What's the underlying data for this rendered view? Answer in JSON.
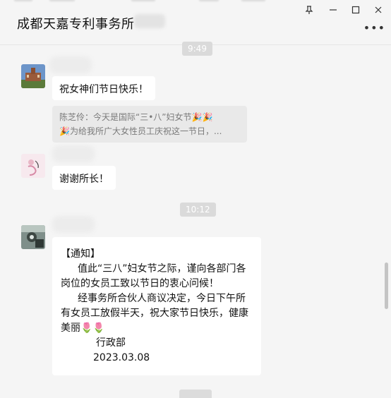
{
  "window": {
    "title": "成都天嘉专利事务所",
    "controls": {
      "pin_icon": "pin-icon",
      "minimize_icon": "minimize-icon",
      "maximize_icon": "maximize-icon",
      "close_icon": "close-icon"
    },
    "more_label": "•••"
  },
  "timestamps": [
    "9:49",
    "10:12"
  ],
  "messages": {
    "m1": {
      "text": "祝女神们节日快乐！"
    },
    "quote": {
      "line1": "陈芝伶：今天是国际“三•八”妇女节🎉🎉",
      "line2": "🎉为给我所广大女性员工庆祝这一节日，..."
    },
    "m2": {
      "text": "谢谢所长！"
    },
    "notice": {
      "head": "【通知】",
      "para1": "值此“三八”妇女节之际，谨向各部门各岗位的女员工致以节日的衷心问候！",
      "para2": "经事务所合伙人商议决定，今日下午所有女员工放假半天，祝大家节日快乐，健康美丽🌷🌷",
      "signature": "行政部",
      "date": "2023.03.08"
    }
  }
}
